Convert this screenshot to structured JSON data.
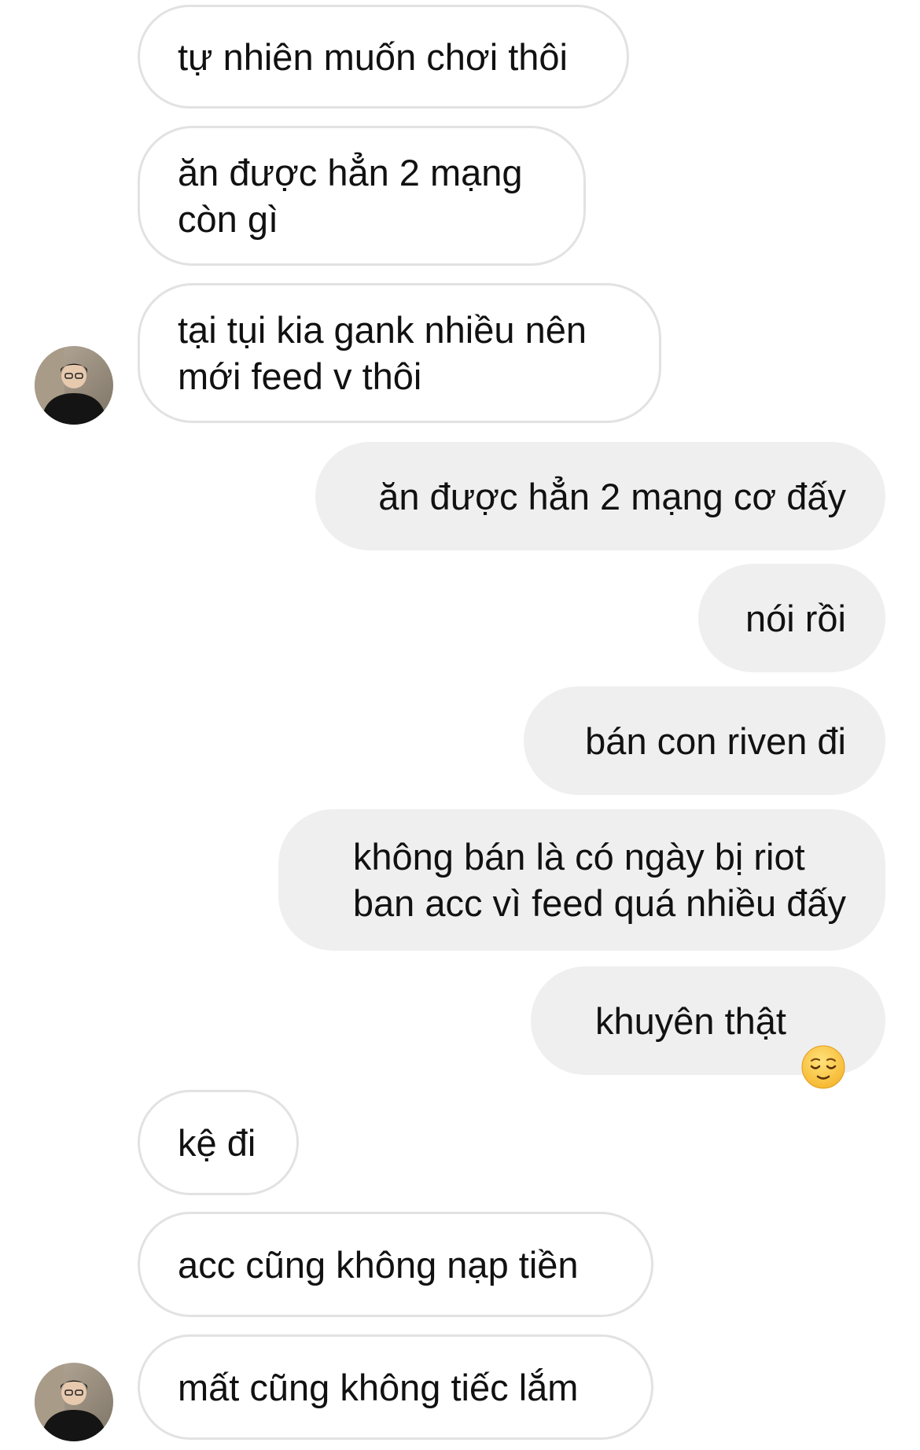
{
  "conversation": {
    "messages": [
      {
        "sender": "other",
        "text": "tự nhiên muốn chơi thôi"
      },
      {
        "sender": "other",
        "text": "ăn được hẳn 2 mạng\ncòn gì"
      },
      {
        "sender": "other",
        "text": "tại tụi kia gank nhiều nên\nmới feed v thôi"
      },
      {
        "sender": "me",
        "text": "ăn được hẳn 2 mạng cơ đấy"
      },
      {
        "sender": "me",
        "text": "nói rồi"
      },
      {
        "sender": "me",
        "text": "bán con riven đi"
      },
      {
        "sender": "me",
        "text": "không bán là có ngày bị riot\nban acc vì feed quá nhiều đấy"
      },
      {
        "sender": "me",
        "text": "khuyên thật",
        "emoji": "relieved-face-emoji"
      },
      {
        "sender": "other",
        "text": "kệ đi"
      },
      {
        "sender": "other",
        "text": "acc cũng không nạp tiền"
      },
      {
        "sender": "other",
        "text": "mất cũng không tiếc lắm"
      }
    ]
  },
  "colors": {
    "incoming_bubble_bg": "#ffffff",
    "incoming_bubble_border": "#e2e2e2",
    "outgoing_bubble_bg": "#efefef",
    "text": "#111111"
  },
  "icons": {
    "avatar": "avatar",
    "emoji": "relieved-face-emoji"
  }
}
